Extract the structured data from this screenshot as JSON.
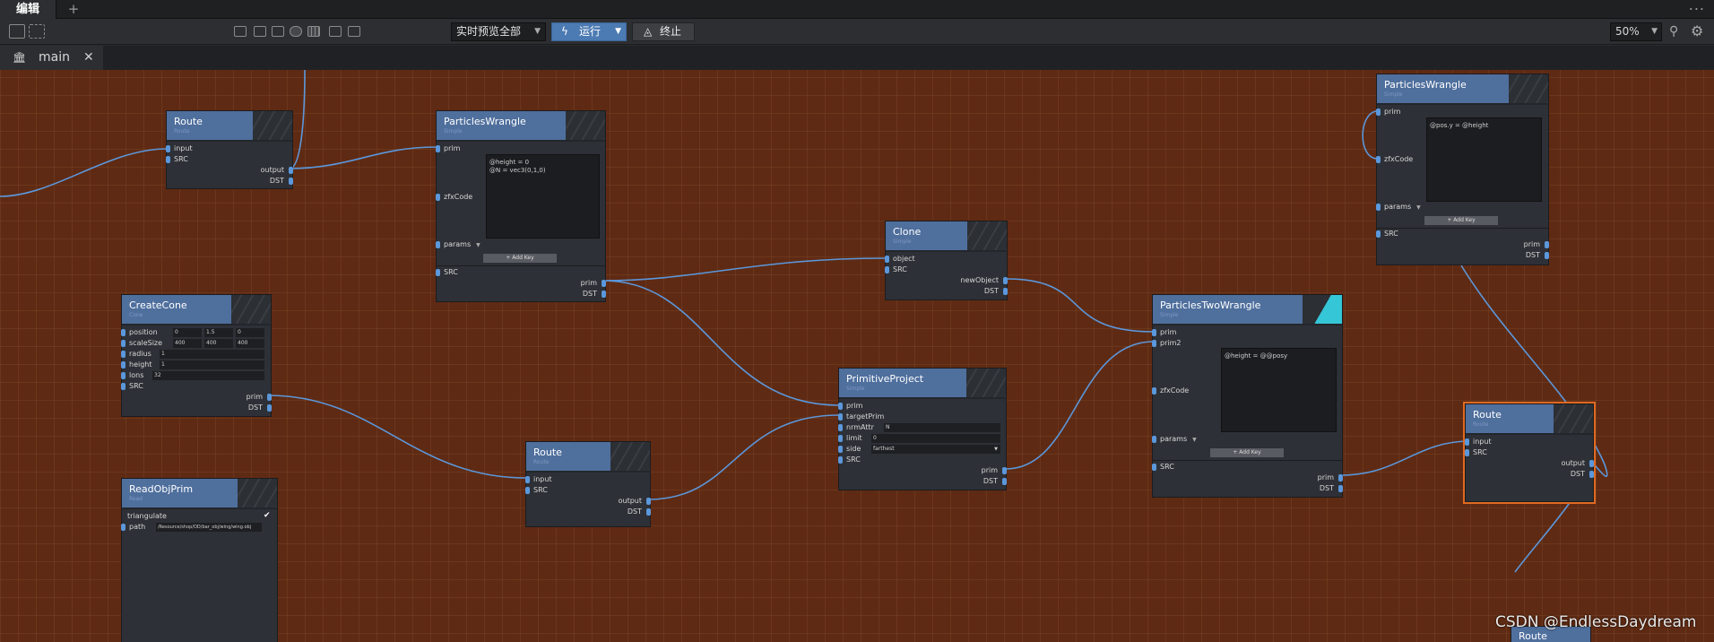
{
  "titlebar": {
    "tab_label": "编辑",
    "add_tab": "+",
    "menu": "..."
  },
  "toolbar": {
    "preview_value": "实时预览全部",
    "run_label": "运行",
    "stop_label": "终止",
    "zoom_value": "50%"
  },
  "subtabs": {
    "main_label": "main",
    "close": "✕"
  },
  "nodes": {
    "route1": {
      "title": "Route",
      "subtitle": "Route",
      "in": [
        "input",
        "SRC"
      ],
      "out": [
        "output",
        "DST"
      ]
    },
    "pw1": {
      "title": "ParticlesWrangle",
      "subtitle": "Simple",
      "in": [
        "prim",
        "zfxCode"
      ],
      "params": "params",
      "addkey": "+ Add Key",
      "src": "SRC",
      "out": [
        "prim",
        "DST"
      ],
      "code": "@height = 0\n@N = vec3(0,1,0)"
    },
    "clone": {
      "title": "Clone",
      "subtitle": "Simple",
      "in": [
        "object",
        "SRC"
      ],
      "out": [
        "newObject",
        "DST"
      ]
    },
    "createcone": {
      "title": "CreateCone",
      "subtitle": "Cone",
      "rows": [
        "position",
        "scaleSize",
        "radius",
        "height",
        "lons",
        "SRC"
      ],
      "position": [
        "0",
        "1.5",
        "0"
      ],
      "scaleSize": [
        "400",
        "400",
        "400"
      ],
      "radius": "1",
      "height": "1",
      "lons": "32",
      "out": [
        "prim",
        "DST"
      ]
    },
    "route2": {
      "title": "Route",
      "subtitle": "Route",
      "in": [
        "input",
        "SRC"
      ],
      "out": [
        "output",
        "DST"
      ]
    },
    "primproject": {
      "title": "PrimitiveProject",
      "subtitle": "Simple",
      "rows": [
        "prim",
        "targetPrim",
        "nrmAttr",
        "limit",
        "side",
        "SRC"
      ],
      "nrmAttr": "N",
      "limit": "0",
      "side": "farthest",
      "out": [
        "prim",
        "DST"
      ]
    },
    "ptw": {
      "title": "ParticlesTwoWrangle",
      "subtitle": "Simple",
      "in": [
        "prim",
        "prim2",
        "zfxCode"
      ],
      "params": "params",
      "addkey": "+ Add Key",
      "src": "SRC",
      "out": [
        "prim",
        "DST"
      ],
      "code": "@height = @@posy"
    },
    "pw2": {
      "title": "ParticlesWrangle",
      "subtitle": "Simple",
      "in": [
        "prim",
        "zfxCode"
      ],
      "params": "params",
      "addkey": "+ Add Key",
      "src": "SRC",
      "out": [
        "prim",
        "DST"
      ],
      "code": "@pos.y = @height"
    },
    "route3": {
      "title": "Route",
      "subtitle": "Route",
      "in": [
        "input",
        "SRC"
      ],
      "out": [
        "output",
        "DST"
      ]
    },
    "readobj": {
      "title": "ReadObjPrim",
      "subtitle": "Read",
      "rows": [
        "triangulate",
        "path"
      ],
      "path": "/Resource/shop/OD/bar_obj/wing/wing.obj"
    },
    "route4": {
      "title": "Route"
    }
  },
  "watermark": "CSDN @EndlessDaydream",
  "colors": {
    "canvas": "#5f2a13",
    "node_header": "#4f6f9d",
    "socket": "#5b97db",
    "run_button": "#4c7ab2",
    "selected": "#e06a22"
  }
}
